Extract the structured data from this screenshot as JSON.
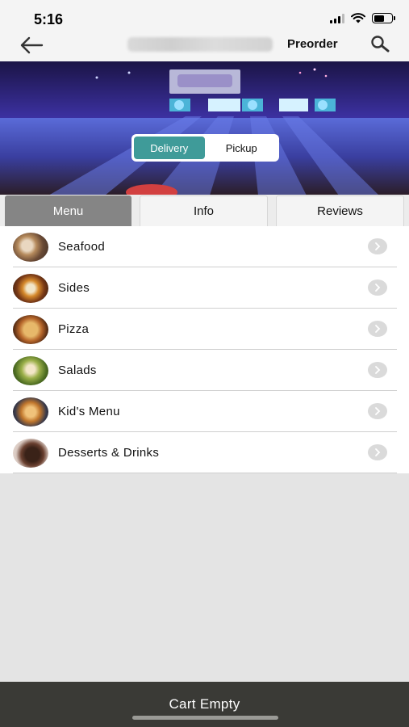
{
  "status_bar": {
    "time": "5:16"
  },
  "nav": {
    "preorder_label": "Preorder"
  },
  "order_toggle": {
    "delivery_label": "Delivery",
    "pickup_label": "Pickup",
    "selected": "Delivery"
  },
  "tabs": [
    {
      "label": "Menu",
      "active": true
    },
    {
      "label": "Info",
      "active": false
    },
    {
      "label": "Reviews",
      "active": false
    }
  ],
  "menu": {
    "items": [
      {
        "label": "Seafood"
      },
      {
        "label": "Sides"
      },
      {
        "label": "Pizza"
      },
      {
        "label": "Salads"
      },
      {
        "label": "Kid's Menu"
      },
      {
        "label": "Desserts & Drinks"
      }
    ]
  },
  "footer": {
    "cart_label": "Cart Empty"
  },
  "colors": {
    "accent": "#3f9b99",
    "tab_active": "#858585",
    "footer_bg": "#3a3a36"
  }
}
